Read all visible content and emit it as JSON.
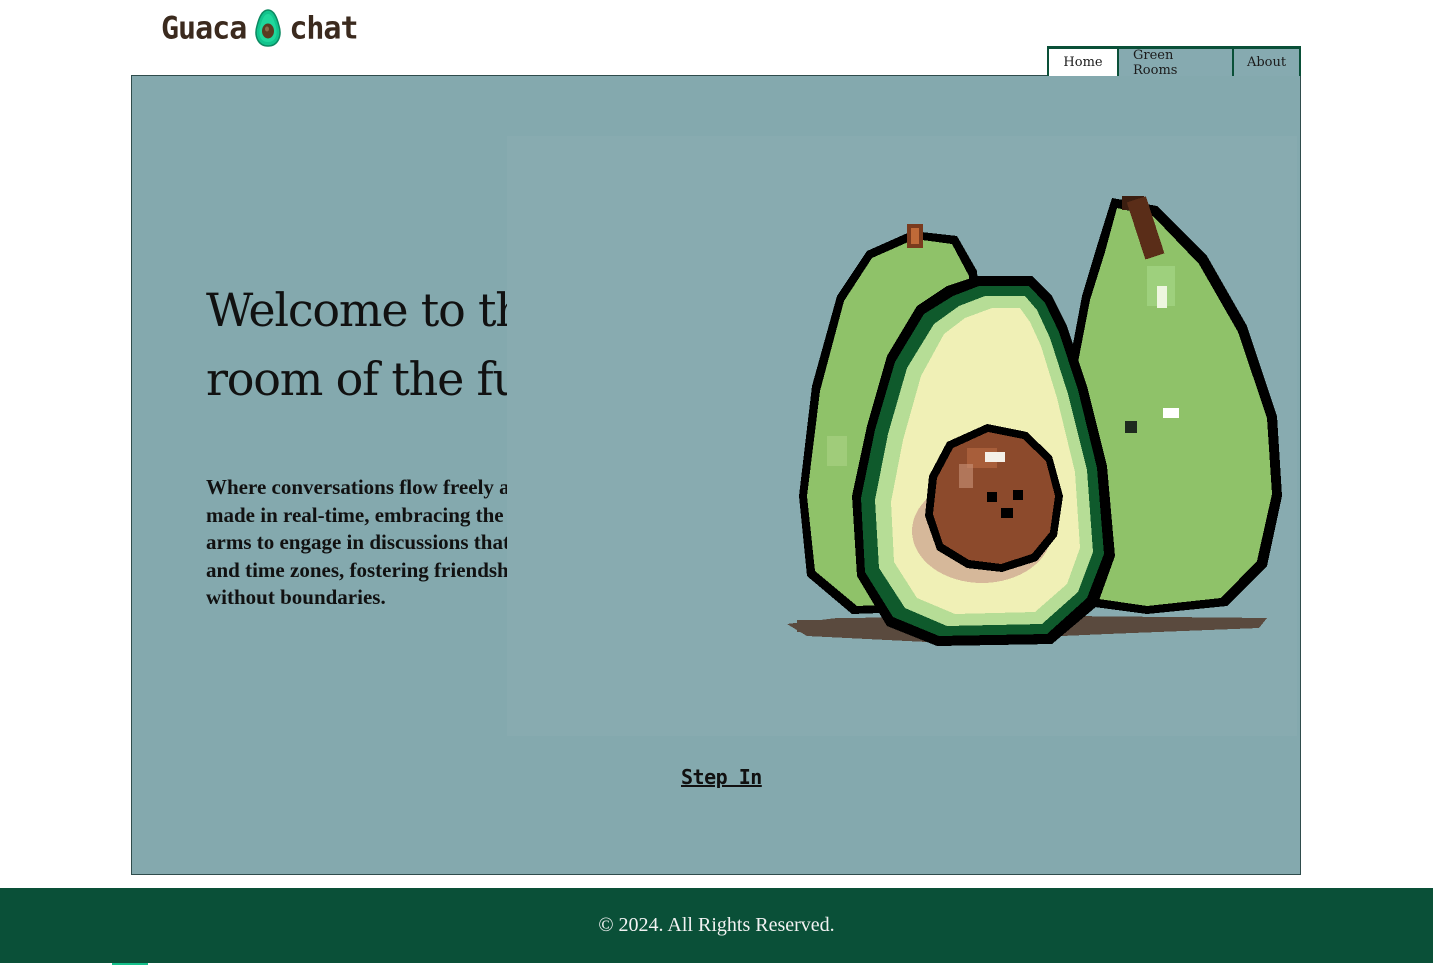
{
  "header": {
    "logo_left": "Guaca",
    "logo_right": "chat",
    "logo_icon": "avocado-icon"
  },
  "nav": {
    "tabs": [
      {
        "label": "Home",
        "active": true
      },
      {
        "label": "Green Rooms",
        "active": false
      },
      {
        "label": "About",
        "active": false
      }
    ]
  },
  "hero": {
    "title_line1": "Welcome to the chat",
    "title_line2": "room of the future",
    "description": "Where conversations flow freely and connections are made in real-time, embracing the digital age with open arms to engage in discussions that transcend borders and time zones, fostering friendships and sharing ideas without boundaries.",
    "illustration": "pixel-avocado-illustration",
    "cta_label": "Step In"
  },
  "footer": {
    "copyright": "© 2024. All Rights Reserved."
  },
  "colors": {
    "brand_green": "#0a5038",
    "panel_bg": "#84a9ae",
    "logo_text": "#3b2a1e",
    "avocado_flesh": "#8fc269",
    "avocado_pit": "#8c4a2c"
  }
}
